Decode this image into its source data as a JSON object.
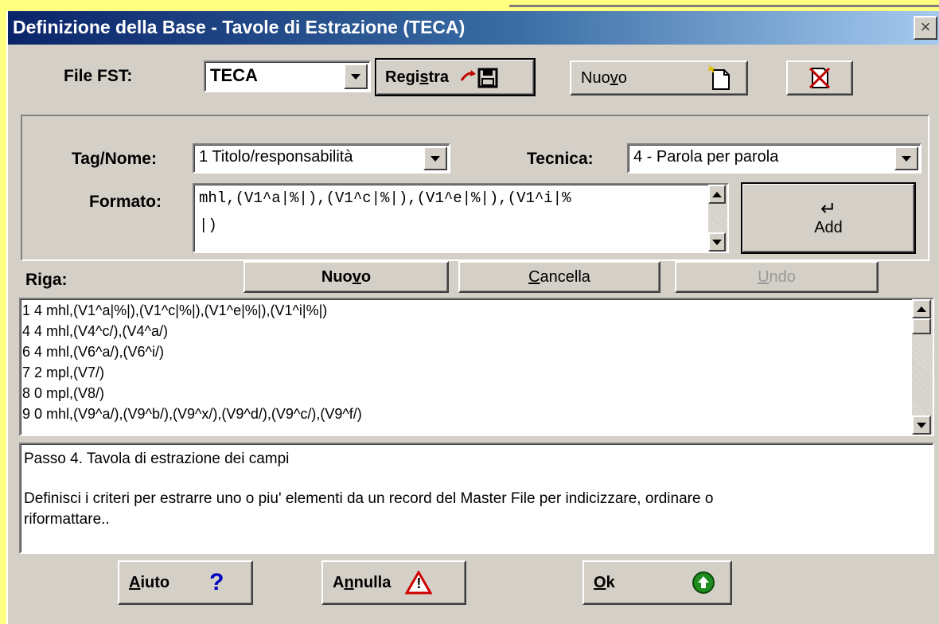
{
  "window": {
    "title": "Definizione della Base - Tavole di Estrazione (TECA)",
    "close_glyph": "×"
  },
  "fst": {
    "label": "File FST:",
    "selected": "TECA",
    "registra_pre": "Regi",
    "registra_u": "s",
    "registra_post": "tra",
    "nuovo_pre": "Nuo",
    "nuovo_u": "v",
    "nuovo_post": "o"
  },
  "edit": {
    "tag_label": "Tag/Nome:",
    "tag_value": "1 Titolo/responsabilità",
    "tecnica_label": "Tecnica:",
    "tecnica_value": "4 - Parola per parola",
    "formato_label": "Formato:",
    "formato_line1": "mhl,(V1^a|%|),(V1^c|%|),(V1^e|%|),(V1^i|%",
    "formato_line2": "|)",
    "add_label": "Add",
    "add_glyph": "↵"
  },
  "riga": {
    "label": "Riga:",
    "nuovo_pre": "Nuo",
    "nuovo_u": "v",
    "nuovo_post": "o",
    "cancella_u": "C",
    "cancella_post": "ancella",
    "undo_u": "U",
    "undo_post": "ndo",
    "rows": [
      "1 4 mhl,(V1^a|%|),(V1^c|%|),(V1^e|%|),(V1^i|%|)",
      "4 4 mhl,(V4^c/),(V4^a/)",
      "6 4 mhl,(V6^a/),(V6^i/)",
      "7 2 mpl,(V7/)",
      "8 0 mpl,(V8/)",
      "9 0 mhl,(V9^a/),(V9^b/),(V9^x/),(V9^d/),(V9^c/),(V9^f/)"
    ]
  },
  "help": {
    "title": "Passo 4. Tavola di estrazione dei campi",
    "body_line1": "Definisci i criteri per estrarre uno o piu' elementi da un record del Master File per indicizzare, ordinare o",
    "body_line2": "riformattare.."
  },
  "bottom": {
    "aiuto_u": "A",
    "aiuto_post": "iuto",
    "aiuto_glyph": "?",
    "annulla_pre": "A",
    "annulla_u": "n",
    "annulla_post": "nulla",
    "annulla_glyph": "!",
    "ok_u": "O",
    "ok_post": "k"
  },
  "colors": {
    "title_start": "#0A246A",
    "title_end": "#A6CAF0",
    "face": "#D4D0C8",
    "desktop": "#FFFF80",
    "ok_green": "#1E8C1E",
    "warn_red": "#D00000",
    "help_blue": "#0000C0"
  }
}
